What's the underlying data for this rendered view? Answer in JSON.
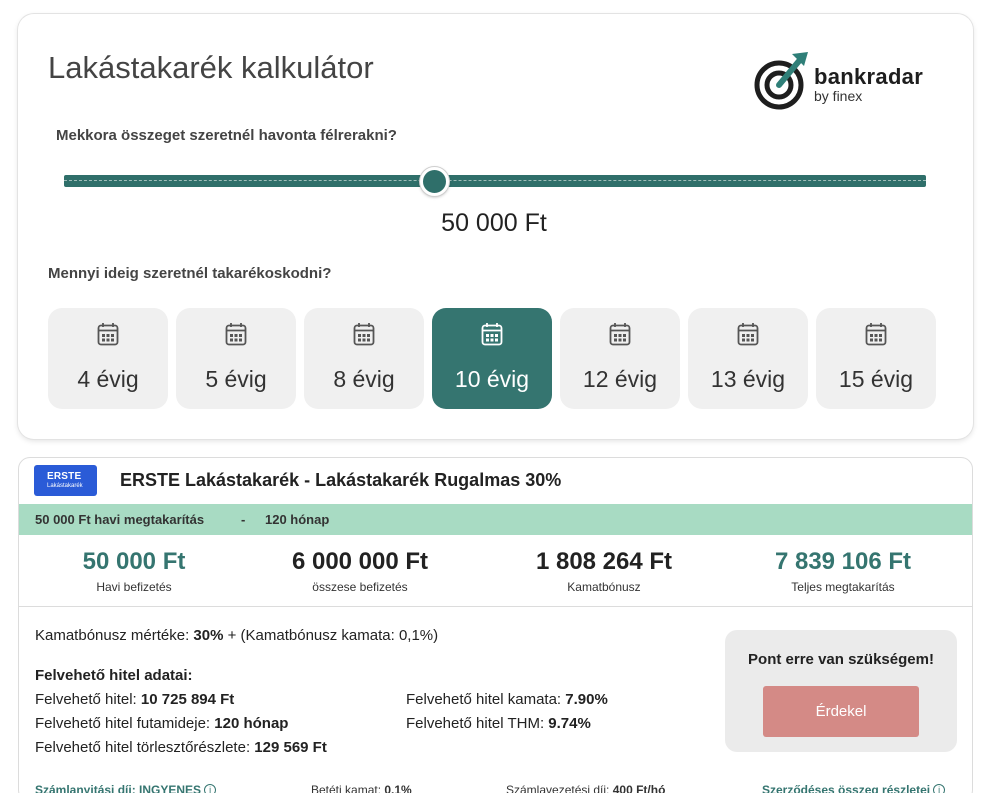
{
  "calculator": {
    "title": "Lakástakarék kalkulátor",
    "logo": {
      "name": "bankradar",
      "sub": "by finex"
    },
    "question_amount": "Mekkora összeget szeretnél havonta félrerakni?",
    "slider": {
      "value_label": "50 000 Ft",
      "position_fraction": 0.43
    },
    "question_duration": "Mennyi ideig szeretnél takarékoskodni?",
    "periods": [
      {
        "label": "4 évig",
        "active": false
      },
      {
        "label": "5 évig",
        "active": false
      },
      {
        "label": "8 évig",
        "active": false
      },
      {
        "label": "10 évig",
        "active": true
      },
      {
        "label": "12 évig",
        "active": false
      },
      {
        "label": "13 évig",
        "active": false
      },
      {
        "label": "15 évig",
        "active": false
      }
    ]
  },
  "offer": {
    "bank_logo": {
      "line1": "ERSTE",
      "line2": "Lakástakarék"
    },
    "title": "ERSTE Lakástakarék - Lakástakarék Rugalmas 30%",
    "band": {
      "monthly": "50 000 Ft havi megtakarítás",
      "sep": "-",
      "months": "120 hónap"
    },
    "stats": [
      {
        "value": "50 000 Ft",
        "label": "Havi befizetés"
      },
      {
        "value": "6 000 000 Ft",
        "label": "összese befizetés"
      },
      {
        "value": "1 808 264 Ft",
        "label": "Kamatbónusz"
      },
      {
        "value": "7 839 106 Ft",
        "label": "Teljes megtakarítás"
      }
    ],
    "bonus": {
      "prefix": "Kamatbónusz mértéke: ",
      "value": "30%",
      "suffix": " + (Kamatbónusz kamata: 0,1%)"
    },
    "loan_heading": "Felvehető hitel adatai:",
    "loan": [
      {
        "label": "Felvehető hitel: ",
        "value": "10 725 894 Ft"
      },
      {
        "label": "Felvehető hitel futamideje: ",
        "value": "120 hónap"
      },
      {
        "label": "Felvehető hitel törlesztőrészlete: ",
        "value": "129 569 Ft"
      },
      {
        "label": "Felvehető hitel kamata: ",
        "value": "7.90%"
      },
      {
        "label": "Felvehető hitel THM: ",
        "value": "9.74%"
      }
    ],
    "cta": {
      "title": "Pont erre van szükségem!",
      "button": "Érdekel"
    },
    "footer": {
      "opening_fee": "Számlanyitási díj: INGYENES",
      "deposit_rate_label": "Betéti kamat: ",
      "deposit_rate_value": "0,1%",
      "account_fee_label": "Számlavezetési díj: ",
      "account_fee_value": "400 Ft/hó",
      "details_link": "Szerződéses összeg részletei",
      "info_glyph": "i"
    }
  },
  "colors": {
    "accent": "#357570",
    "band": "#a8dbc3",
    "cta": "#d48a86",
    "bank_blue": "#2a5bd7"
  }
}
